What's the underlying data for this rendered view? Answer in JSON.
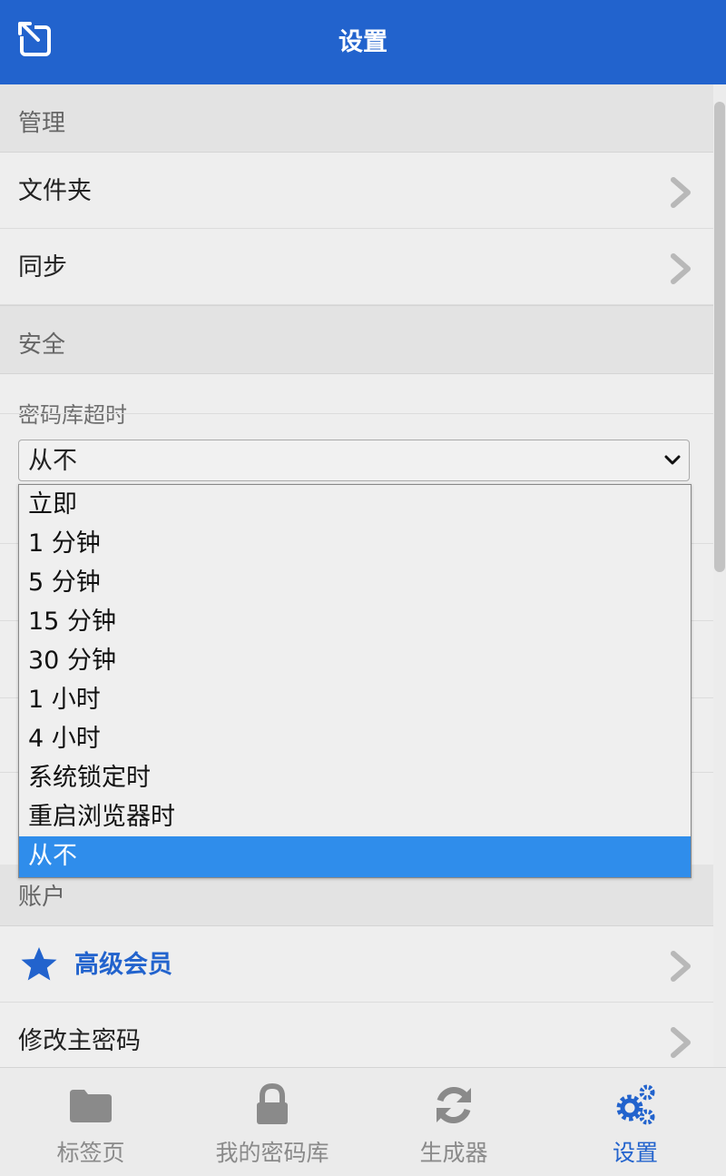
{
  "header": {
    "title": "设置",
    "popout_icon": "popout-icon"
  },
  "sections": {
    "manage": {
      "label": "管理",
      "items": [
        {
          "label": "文件夹"
        },
        {
          "label": "同步"
        }
      ]
    },
    "security": {
      "label": "安全",
      "vault_timeout": {
        "label": "密码库超时",
        "value": "从不",
        "options": [
          "立即",
          "1 分钟",
          "5 分钟",
          "15 分钟",
          "30 分钟",
          "1 小时",
          "4 小时",
          "系统锁定时",
          "重启浏览器时",
          "从不"
        ],
        "selected_index": 9
      }
    },
    "account": {
      "label": "账户",
      "items": [
        {
          "label": "高级会员",
          "icon": "star-icon"
        },
        {
          "label": "修改主密码"
        }
      ]
    }
  },
  "tabs": [
    {
      "label": "标签页",
      "icon": "folder-icon",
      "active": false
    },
    {
      "label": "我的密码库",
      "icon": "lock-icon",
      "active": false
    },
    {
      "label": "生成器",
      "icon": "refresh-icon",
      "active": false
    },
    {
      "label": "设置",
      "icon": "gears-icon",
      "active": true
    }
  ],
  "colors": {
    "brand": "#2263cd",
    "selected_option": "#2f8deb"
  }
}
